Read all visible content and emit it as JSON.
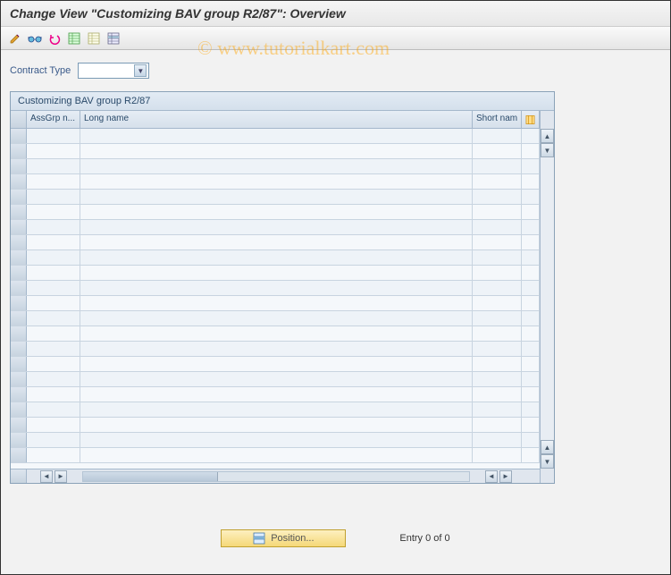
{
  "header": {
    "title": "Change View \"Customizing BAV group R2/87\": Overview"
  },
  "watermark": "© www.tutorialkart.com",
  "toolbar": {
    "icons": [
      "other-view",
      "glasses",
      "undo",
      "new-entries",
      "copy",
      "delimit"
    ]
  },
  "form": {
    "contract_type_label": "Contract Type",
    "contract_type_value": ""
  },
  "table": {
    "title": "Customizing BAV group R2/87",
    "columns": {
      "assgrp": "AssGrp n...",
      "long": "Long name",
      "short": "Short nam"
    },
    "row_count": 22
  },
  "footer": {
    "position_label": "Position...",
    "entry_text": "Entry 0 of 0"
  }
}
